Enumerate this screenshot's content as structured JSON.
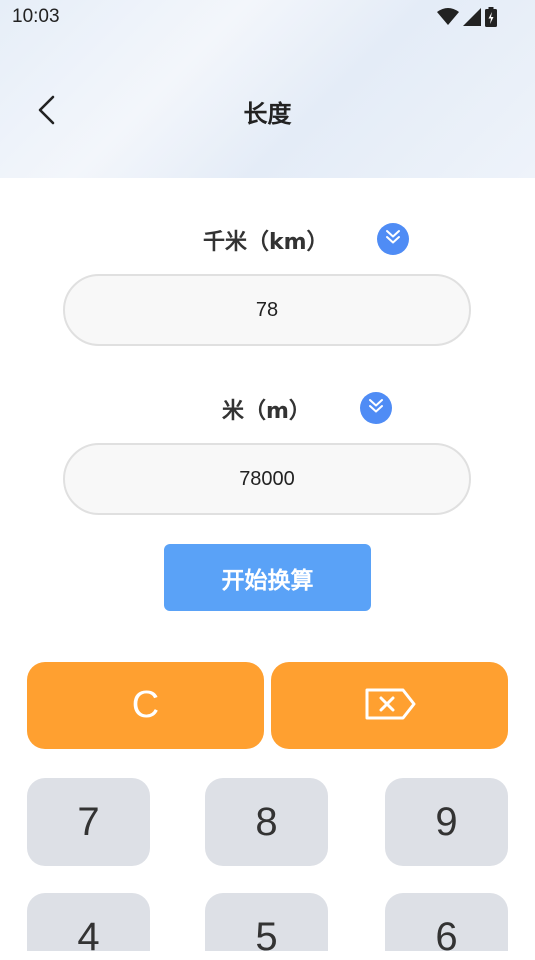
{
  "status_bar": {
    "time": "10:03",
    "icons": [
      "wifi-icon",
      "signal-icon",
      "battery-icon"
    ]
  },
  "header": {
    "title": "长度",
    "back_icon": "chevron-left-icon"
  },
  "converter": {
    "from_unit": {
      "label": "千米（km）",
      "value": "78",
      "dropdown_icon": "double-chevron-down-icon"
    },
    "to_unit": {
      "label": "米（m）",
      "value": "78000",
      "dropdown_icon": "double-chevron-down-icon"
    },
    "convert_button_label": "开始换算"
  },
  "keypad": {
    "clear_label": "C",
    "backspace_icon": "backspace-icon",
    "rows": [
      [
        "7",
        "8",
        "9"
      ],
      [
        "4",
        "5",
        "6"
      ]
    ]
  },
  "colors": {
    "accent_blue": "#4f8cf5",
    "button_blue": "#5aa2f7",
    "key_orange": "#ffa030",
    "key_gray": "#dde0e6"
  }
}
